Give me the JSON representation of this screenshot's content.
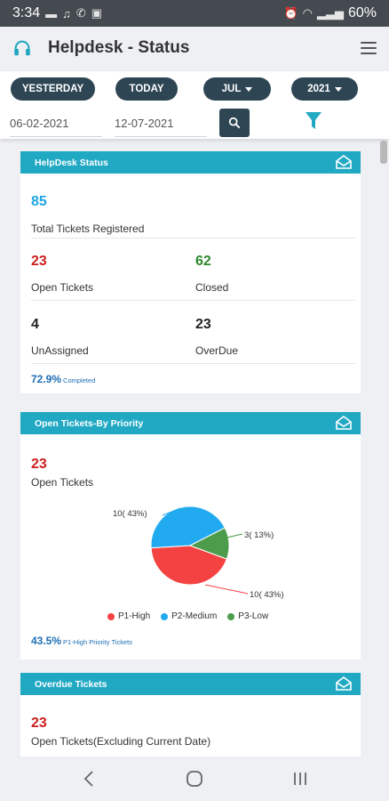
{
  "status_bar": {
    "time": "3:34",
    "battery": "60%"
  },
  "app": {
    "title": "Helpdesk - Status"
  },
  "filters": {
    "yesterday_label": "YESTERDAY",
    "today_label": "TODAY",
    "month": "JUL",
    "year": "2021",
    "from_date": "06-02-2021",
    "to_date": "12-07-2021"
  },
  "helpdesk_status": {
    "title": "HelpDesk Status",
    "total_tickets": "85",
    "total_tickets_label": "Total Tickets Registered",
    "open_tickets": "23",
    "open_tickets_label": "Open Tickets",
    "closed": "62",
    "closed_label": "Closed",
    "unassigned": "4",
    "unassigned_label": "UnAssigned",
    "overdue": "23",
    "overdue_label": "OverDue",
    "completed_pct": "72.9%",
    "completed_label": "Completed"
  },
  "by_priority": {
    "title": "Open Tickets-By Priority",
    "open_tickets": "23",
    "open_tickets_label": "Open Tickets",
    "high_pct": "43.5%",
    "high_pct_label": "P1-High Priority Tickets"
  },
  "chart_data": {
    "type": "pie",
    "series": [
      {
        "name": "P1-High",
        "value": 10,
        "label": "10( 43%)",
        "color": "#f44242"
      },
      {
        "name": "P2-Medium",
        "value": 10,
        "label": "10( 43%)",
        "color": "#22aaf0"
      },
      {
        "name": "P3-Low",
        "value": 3,
        "label": "3( 13%)",
        "color": "#4c9c4c"
      }
    ],
    "legend_position": "bottom"
  },
  "overdue_tickets": {
    "title": "Overdue Tickets",
    "count": "23",
    "label": "Open Tickets(Excluding Current Date)"
  },
  "colors": {
    "accent": "#21a9c4",
    "dark_button": "#2e4654",
    "open_red": "#cc1f1f",
    "closed_green": "#2d8a2d",
    "total_blue": "#1ea6e0"
  }
}
